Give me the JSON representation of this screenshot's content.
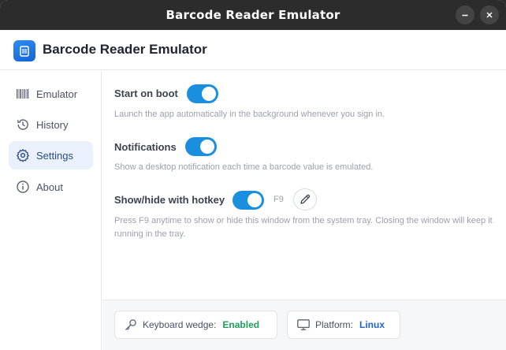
{
  "window": {
    "title": "Barcode Reader Emulator"
  },
  "header": {
    "title": "Barcode Reader Emulator"
  },
  "sidebar": {
    "items": [
      {
        "label": "Emulator",
        "icon": "barcode-icon",
        "active": false
      },
      {
        "label": "History",
        "icon": "history-icon",
        "active": false
      },
      {
        "label": "Settings",
        "icon": "gear-icon",
        "active": true
      },
      {
        "label": "About",
        "icon": "info-icon",
        "active": false
      }
    ]
  },
  "settings": {
    "start_on_boot": {
      "title": "Start on boot",
      "description": "Launch the app automatically in the background whenever you sign in.",
      "enabled": true
    },
    "notifications": {
      "title": "Notifications",
      "description": "Show a desktop notification each time a barcode value is emulated.",
      "enabled": true
    },
    "hotkey": {
      "title": "Show/hide with hotkey",
      "key": "F9",
      "description": "Press F9 anytime to show or hide this window from the system tray. Closing the window will keep it running in the tray.",
      "enabled": true
    }
  },
  "footer": {
    "keyboard_wedge": {
      "label": "Keyboard wedge:",
      "value": "Enabled",
      "value_color": "#1e9e5a"
    },
    "platform": {
      "label": "Platform:",
      "value": "Linux",
      "value_color": "#1f64d8"
    }
  },
  "colors": {
    "accent": "#1a8fe0",
    "titlebar": "#2c2c2c"
  }
}
